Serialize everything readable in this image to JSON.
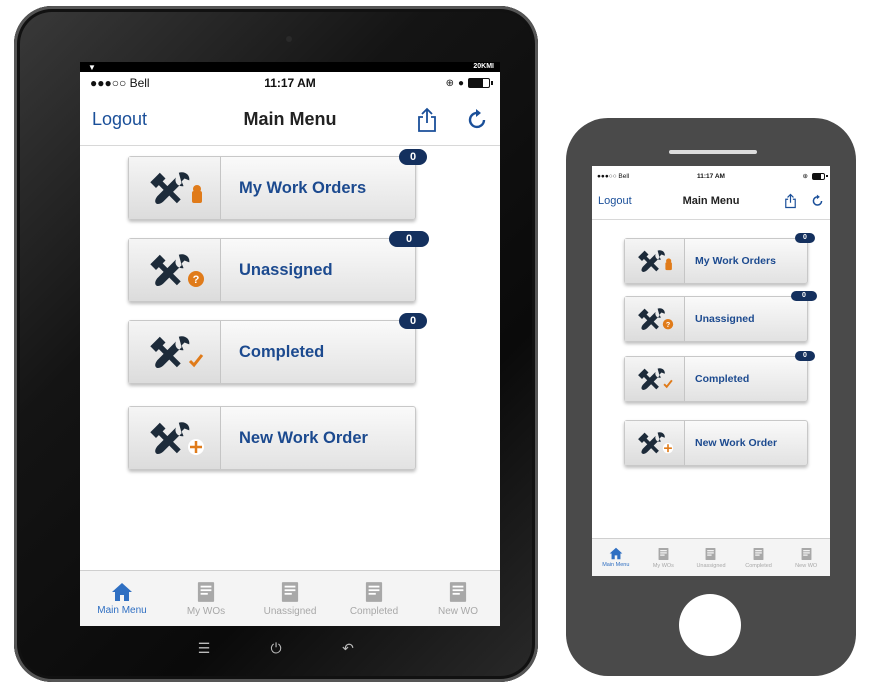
{
  "tablet": {
    "status": {
      "carrier": "●●●○○ Bell",
      "time": "11:17 AM",
      "top_strip_right": "20KMI"
    },
    "nav": {
      "left": "Logout",
      "title": "Main Menu"
    },
    "menu": [
      {
        "label": "My Work Orders",
        "badge": "0"
      },
      {
        "label": "Unassigned",
        "badge": "0"
      },
      {
        "label": "Completed",
        "badge": "0"
      },
      {
        "label": "New Work Order"
      }
    ],
    "tabs": [
      {
        "label": "Main Menu",
        "icon": "home-icon"
      },
      {
        "label": "My WOs",
        "icon": "doc-person-icon"
      },
      {
        "label": "Unassigned",
        "icon": "doc-question-icon"
      },
      {
        "label": "Completed",
        "icon": "doc-check-icon"
      },
      {
        "label": "New WO",
        "icon": "doc-plus-icon"
      }
    ]
  },
  "phone": {
    "status": {
      "carrier": "●●●○○ Bell",
      "time": "11:17 AM"
    },
    "nav": {
      "left": "Logout",
      "title": "Main Menu"
    },
    "menu": [
      {
        "label": "My Work Orders",
        "badge": "0"
      },
      {
        "label": "Unassigned",
        "badge": "0"
      },
      {
        "label": "Completed",
        "badge": "0"
      },
      {
        "label": "New Work Order"
      }
    ],
    "tabs": [
      {
        "label": "Main Menu"
      },
      {
        "label": "My WOs"
      },
      {
        "label": "Unassigned"
      },
      {
        "label": "Completed"
      },
      {
        "label": "New WO"
      }
    ]
  },
  "colors": {
    "accent": "#2f6fc2",
    "label": "#1c4a8f",
    "badge": "#14305e",
    "active_tab": "#2f6fc2",
    "overlay_orange": "#e07b1a"
  },
  "icons": [
    "tools-person-icon",
    "tools-question-icon",
    "tools-check-icon",
    "tools-plus-icon",
    "share-icon",
    "refresh-icon"
  ]
}
